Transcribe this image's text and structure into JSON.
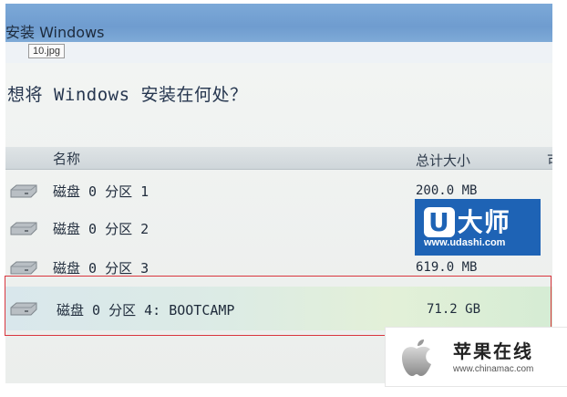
{
  "window": {
    "title": "安装 Windows"
  },
  "image_label": "10.jpg",
  "prompt": "想将 Windows 安装在何处？",
  "columns": {
    "name": "名称",
    "size": "总计大小",
    "more": "可"
  },
  "partitions": [
    {
      "name": "磁盘 0 分区 1",
      "size": "200.0 MB"
    },
    {
      "name": "磁盘 0 分区 2",
      "size": ""
    },
    {
      "name": "磁盘 0 分区 3",
      "size": "619.0 MB"
    },
    {
      "name": "磁盘 0 分区 4: BOOTCAMP",
      "size": "71.2 GB",
      "selected": true
    }
  ],
  "logo": {
    "brand_u": "U",
    "brand_text": "大师",
    "url": "www.udashi.com"
  },
  "watermark": {
    "title": "苹果在线",
    "url": "www.chinamac.com"
  },
  "colors": {
    "selection_border": "#d9363e",
    "titlebar": "#6f9ccf",
    "logo_bg": "#1e63b5"
  }
}
